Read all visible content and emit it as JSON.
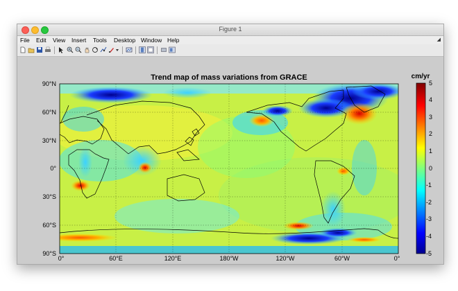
{
  "window": {
    "title": "Figure 1"
  },
  "menu": [
    "File",
    "Edit",
    "View",
    "Insert",
    "Tools",
    "Desktop",
    "Window",
    "Help"
  ],
  "toolbar_icons": [
    "new-file-icon",
    "open-folder-icon",
    "save-icon",
    "print-icon",
    "pointer-icon",
    "zoom-in-icon",
    "zoom-out-icon",
    "pan-hand-icon",
    "rotate-3d-icon",
    "data-cursor-icon",
    "brush-icon",
    "brush-dropdown-icon",
    "link-plot-icon",
    "colorbar-icon",
    "legend-icon",
    "hide-plot-tools-icon",
    "show-plot-tools-icon"
  ],
  "plot": {
    "title": "Trend map of mass variations from GRACE",
    "y_ticks": [
      "90°N",
      "60°N",
      "30°N",
      "0°",
      "30°S",
      "60°S",
      "90°S"
    ],
    "x_ticks": [
      "0°",
      "60°E",
      "120°E",
      "180°W",
      "120°W",
      "60°W",
      "0°"
    ],
    "colorbar_label": "cm/yr",
    "colorbar_ticks": [
      "5",
      "4",
      "3",
      "2",
      "1",
      "0",
      "-1",
      "-2",
      "-3",
      "-4",
      "-5"
    ],
    "colormap": "jet",
    "colors": {
      "negative": "#00008f",
      "zero": "#7fff7f",
      "positive": "#800000"
    }
  }
}
